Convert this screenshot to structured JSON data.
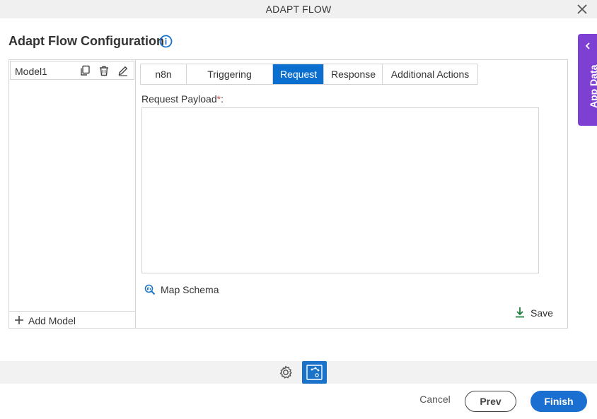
{
  "window": {
    "title": "ADAPT FLOW",
    "close_icon": "close-icon"
  },
  "page": {
    "title": "Adapt Flow Configuration",
    "info_icon": "info-icon"
  },
  "models": {
    "items": [
      {
        "name": "Model1",
        "icons": [
          "copy-icon",
          "delete-icon",
          "edit-icon"
        ]
      }
    ],
    "add_label": "Add Model"
  },
  "tabs": [
    {
      "label": "n8n",
      "active": false
    },
    {
      "label": "Triggering Event",
      "active": false
    },
    {
      "label": "Request",
      "active": true
    },
    {
      "label": "Response",
      "active": false
    },
    {
      "label": "Additional Actions",
      "active": false
    }
  ],
  "request": {
    "payload_label": "Request Payload",
    "required_marker": "*",
    "label_suffix": ":",
    "payload_value": "",
    "map_schema_label": "Map Schema",
    "save_label": "Save"
  },
  "side_panel": {
    "label": "App Data"
  },
  "footer": {
    "cancel_label": "Cancel",
    "prev_label": "Prev",
    "finish_label": "Finish"
  },
  "colors": {
    "accent": "#0a6fcf",
    "side_panel": "#7e3fd3",
    "required": "#d9534f",
    "save_icon": "#1e7d3a"
  }
}
